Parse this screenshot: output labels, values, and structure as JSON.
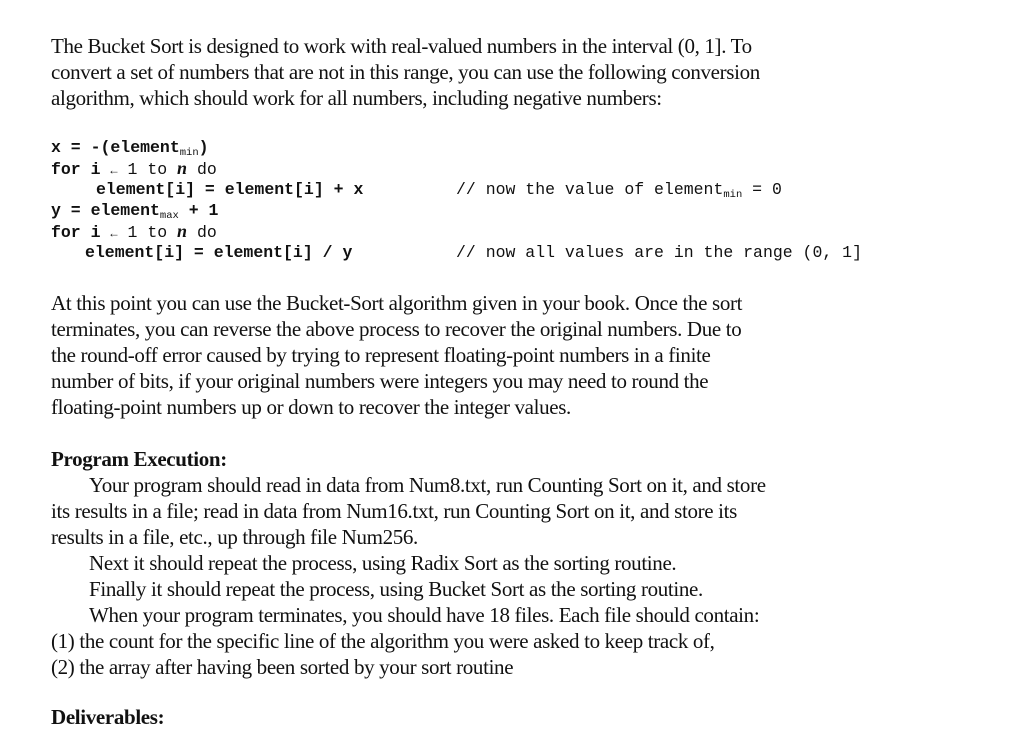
{
  "intro": {
    "lines": [
      "The Bucket Sort is designed to work with real-valued numbers in the interval (0, 1].  To",
      "convert a set of numbers that are not in this range, you can use the following conversion",
      "algorithm, which should work for all numbers, including negative numbers:"
    ]
  },
  "code": {
    "line1": {
      "a": "x = -(element",
      "sub": "min",
      "b": ")"
    },
    "line2": {
      "a": "for i ",
      "arrow": "←",
      "b": " 1 to ",
      "n": "n",
      "c": " do"
    },
    "line3": {
      "a": "element[i] = element[i] + x",
      "comment_a": "// now the value of element",
      "comment_sub": "min",
      "comment_b": " = 0"
    },
    "line4": {
      "a": "y = element",
      "sub": "max",
      "b": " + 1"
    },
    "line5": {
      "a": "for i ",
      "arrow": "←",
      "b": " 1 to ",
      "n": "n",
      "c": " do"
    },
    "line6": {
      "a": "element[i] = element[i] / y",
      "comment": "// now all values are in the range (0, 1]"
    }
  },
  "after_code": {
    "lines": [
      "At this point you can use the Bucket-Sort algorithm given in your book.  Once the sort",
      "terminates, you can reverse the above process to recover the original numbers.  Due to",
      "the round-off error caused by trying to represent floating-point numbers in a finite",
      "number of bits, if your original numbers were integers you may need to round the",
      "floating-point numbers up or down to recover the integer values."
    ]
  },
  "program_execution": {
    "heading": "Program Execution:",
    "lines": [
      "Your program should read in data from Num8.txt, run Counting Sort on it, and store",
      "its results in a file; read in data from Num16.txt, run Counting Sort on it, and store its",
      "results in a file, etc., up through file Num256.",
      "Next it should repeat the process, using Radix Sort as the sorting routine.",
      "Finally it should repeat the process, using Bucket Sort as the sorting routine.",
      "When your program terminates, you should have 18 files.  Each file should contain:",
      "(1) the count for the specific line of the algorithm you were asked to keep track of,",
      "(2) the array after having been sorted by your sort routine"
    ]
  },
  "deliverables": {
    "heading": "Deliverables:"
  }
}
